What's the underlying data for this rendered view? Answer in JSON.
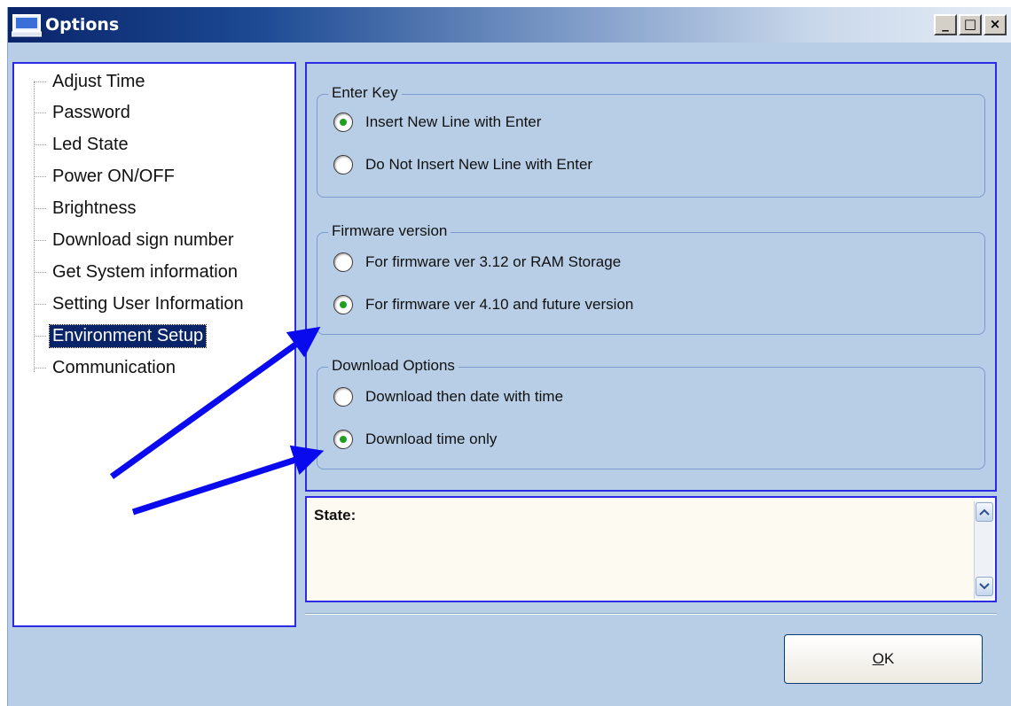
{
  "window": {
    "title": "Options"
  },
  "tree": {
    "items": [
      {
        "label": "Adjust Time"
      },
      {
        "label": "Password"
      },
      {
        "label": "Led State"
      },
      {
        "label": "Power ON/OFF"
      },
      {
        "label": "Brightness"
      },
      {
        "label": "Download sign number"
      },
      {
        "label": "Get System information"
      },
      {
        "label": "Setting User Information"
      },
      {
        "label": "Environment Setup",
        "selected": true
      },
      {
        "label": "Communication"
      }
    ]
  },
  "groups": {
    "enter_key": {
      "title": "Enter Key",
      "options": [
        {
          "label": "Insert New Line with Enter",
          "checked": true
        },
        {
          "label": "Do Not Insert New Line with Enter",
          "checked": false
        }
      ]
    },
    "firmware": {
      "title": "Firmware version",
      "options": [
        {
          "label": "For firmware ver 3.12 or RAM Storage",
          "checked": false
        },
        {
          "label": "For firmware ver 4.10 and future version",
          "checked": true
        }
      ]
    },
    "download": {
      "title": "Download Options",
      "options": [
        {
          "label": "Download then date with time",
          "checked": false
        },
        {
          "label": "Download time only",
          "checked": true
        }
      ]
    }
  },
  "state": {
    "label": "State:"
  },
  "ok_button": {
    "label_prefix": "",
    "label_mnemonic": "O",
    "label_rest": "K"
  },
  "colors": {
    "accent": "#2b2be6",
    "radio_dot": "#20a020",
    "selection": "#0a246a"
  }
}
